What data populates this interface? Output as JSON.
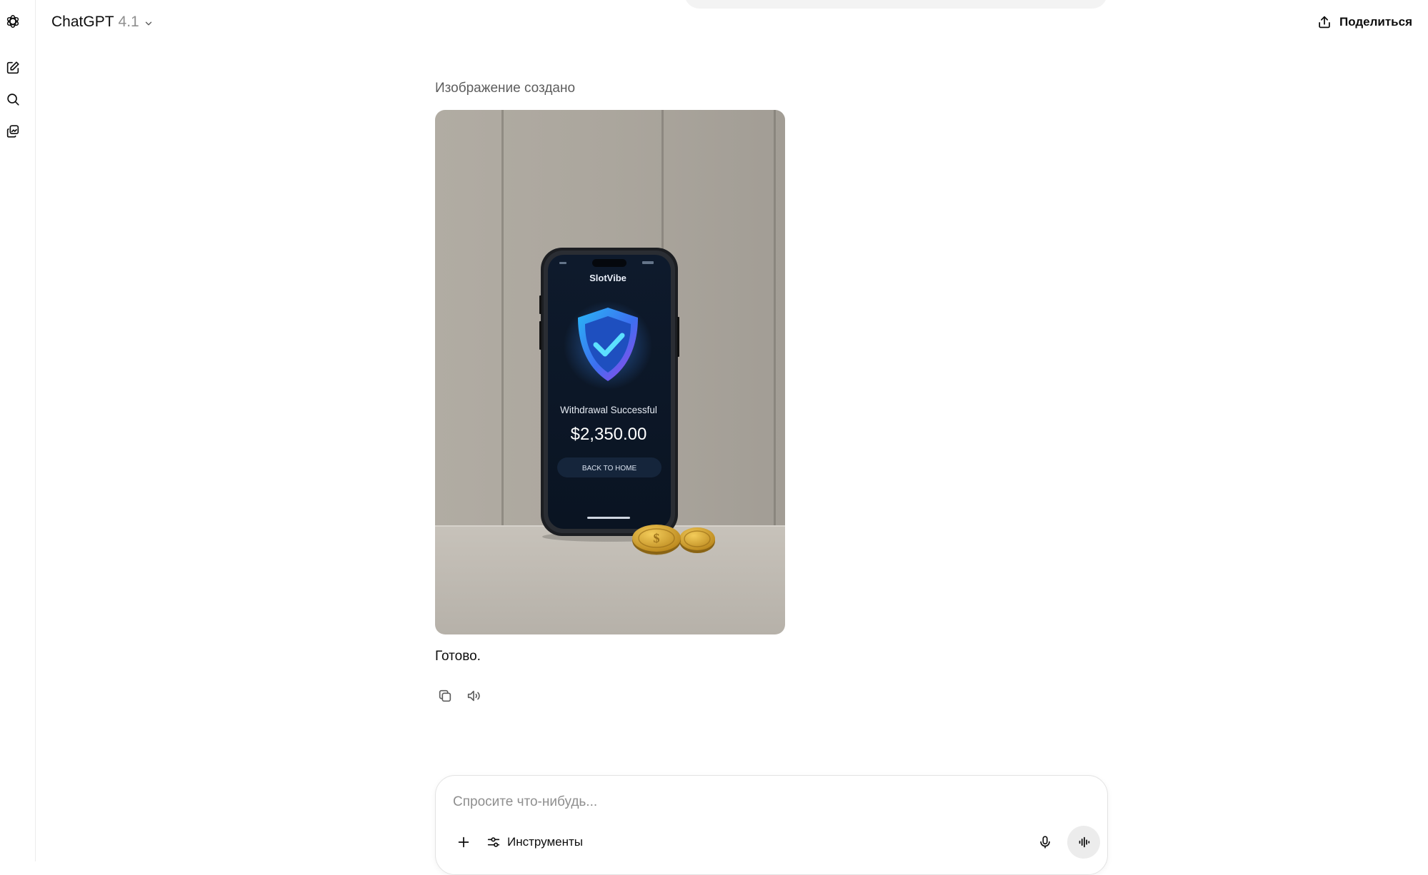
{
  "header": {
    "model_name": "ChatGPT",
    "model_version": "4.1",
    "share_label": "Поделиться"
  },
  "rail": {
    "icons": [
      "openai-logo-icon",
      "new-chat-icon",
      "search-icon",
      "library-icon"
    ]
  },
  "message": {
    "image_caption": "Изображение создано",
    "image": {
      "app_name": "SlotVibe",
      "status_text": "Withdrawal Successful",
      "amount": "$2,350.00",
      "button_label": "BACK TO HOME"
    },
    "reply_text": "Готово."
  },
  "composer": {
    "placeholder": "Спросите что-нибудь...",
    "tools_label": "Инструменты"
  }
}
